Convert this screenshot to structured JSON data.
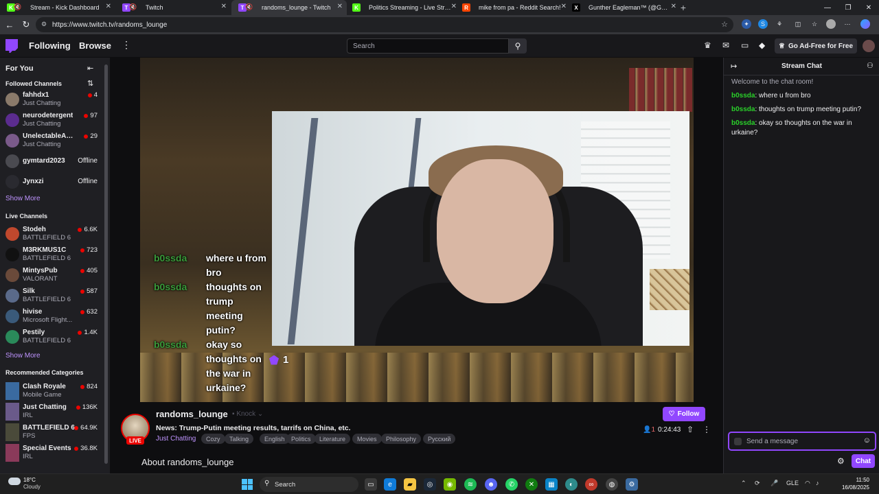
{
  "browser": {
    "tabs": [
      {
        "label": "Stream - Kick Dashboard",
        "fav": "K",
        "color": "#53fc18"
      },
      {
        "label": "Twitch",
        "fav": "T",
        "color": "#9147ff"
      },
      {
        "label": "randoms_lounge - Twitch",
        "fav": "T",
        "color": "#9147ff"
      },
      {
        "label": "Politics Streaming - Live Streams",
        "fav": "K",
        "color": "#53fc18"
      },
      {
        "label": "mike from pa - Reddit Search!",
        "fav": "R",
        "color": "#ff4500"
      },
      {
        "label": "Gunther Eagleman™ (@GuntherE",
        "fav": "X",
        "color": "#000000"
      }
    ],
    "url": "https://www.twitch.tv/randoms_lounge"
  },
  "topnav": {
    "following": "Following",
    "browse": "Browse",
    "search_placeholder": "Search",
    "ad_free": "Go Ad-Free for Free"
  },
  "sidebar": {
    "for_you": "For You",
    "followed_heading": "Followed Channels",
    "followed": [
      {
        "name": "fahhdx1",
        "category": "Just Chatting",
        "viewers": "4",
        "avatar": "#8a7a6a"
      },
      {
        "name": "neurodetergent",
        "category": "Just Chatting",
        "viewers": "97",
        "avatar": "#5b2c8f"
      },
      {
        "name": "UnelectableAir...",
        "category": "Just Chatting",
        "viewers": "29",
        "avatar": "#7a5a8a"
      },
      {
        "name": "gymtard2023",
        "category": "",
        "viewers": "Offline",
        "avatar": "#4a4a50"
      },
      {
        "name": "Jynxzi",
        "category": "",
        "viewers": "Offline",
        "avatar": "#2a2a30"
      }
    ],
    "show_more_1": "Show More",
    "live_heading": "Live Channels",
    "live": [
      {
        "name": "Stodeh",
        "category": "BATTLEFIELD 6",
        "viewers": "6.6K",
        "avatar": "#c0482d"
      },
      {
        "name": "M3RKMUS1C",
        "category": "BATTLEFIELD 6",
        "viewers": "723",
        "avatar": "#111111"
      },
      {
        "name": "MintysPub",
        "category": "VALORANT",
        "viewers": "405",
        "avatar": "#6a4a3a"
      },
      {
        "name": "Silk",
        "category": "BATTLEFIELD 6",
        "viewers": "587",
        "avatar": "#5a6a8a"
      },
      {
        "name": "hivise",
        "category": "Microsoft Flight...",
        "viewers": "632",
        "avatar": "#3a5a7a"
      },
      {
        "name": "Pestily",
        "category": "BATTLEFIELD 6",
        "viewers": "1.4K",
        "avatar": "#2a8a5a"
      }
    ],
    "show_more_2": "Show More",
    "recommended_heading": "Recommended Categories",
    "recommended": [
      {
        "name": "Clash Royale",
        "category": "Mobile Game",
        "viewers": "824",
        "avatar": "#3a6aa0"
      },
      {
        "name": "Just Chatting",
        "category": "IRL",
        "viewers": "136K",
        "avatar": "#6a5a8a"
      },
      {
        "name": "BATTLEFIELD 6",
        "category": "FPS",
        "viewers": "64.9K",
        "avatar": "#4a4a3a"
      },
      {
        "name": "Special Events",
        "category": "IRL",
        "viewers": "36.8K",
        "avatar": "#8a3a5a"
      }
    ]
  },
  "overlay": {
    "messages": [
      {
        "user": "b0ssda",
        "lines": [
          "where u from",
          "bro"
        ]
      },
      {
        "user": "b0ssda",
        "lines": [
          "thoughts on",
          "trump",
          "meeting",
          "putin?"
        ]
      },
      {
        "user": "b0ssda",
        "lines": [
          "okay so",
          "thoughts on",
          "the war in",
          "urkaine?"
        ]
      }
    ],
    "cheer_count": "1"
  },
  "stream": {
    "channel": "randoms_lounge",
    "knock": "Knock",
    "live": "LIVE",
    "title": "News: Trump-Putin meeting results, tarrifs on China, etc.",
    "category": "Just Chatting",
    "tags": [
      "Cozy",
      "Talking",
      "English",
      "Politics",
      "Literature",
      "Movies",
      "Philosophy",
      "Русский"
    ],
    "follow": "Follow",
    "viewers": "1",
    "uptime": "0:24:43",
    "about": "About randoms_lounge"
  },
  "chat": {
    "title": "Stream Chat",
    "welcome": "Welcome to the chat room!",
    "messages": [
      {
        "user": "b0ssda",
        "text": "where u from bro"
      },
      {
        "user": "b0ssda",
        "text": "thoughts on trump meeting putin?"
      },
      {
        "user": "b0ssda",
        "text": "okay so thoughts on the war in urkaine?"
      }
    ],
    "input_placeholder": "Send a message",
    "chat_button": "Chat"
  },
  "taskbar": {
    "temp": "18°C",
    "condition": "Cloudy",
    "search": "Search",
    "lang": "GLE",
    "time": "11:50",
    "date": "16/08/2025"
  }
}
